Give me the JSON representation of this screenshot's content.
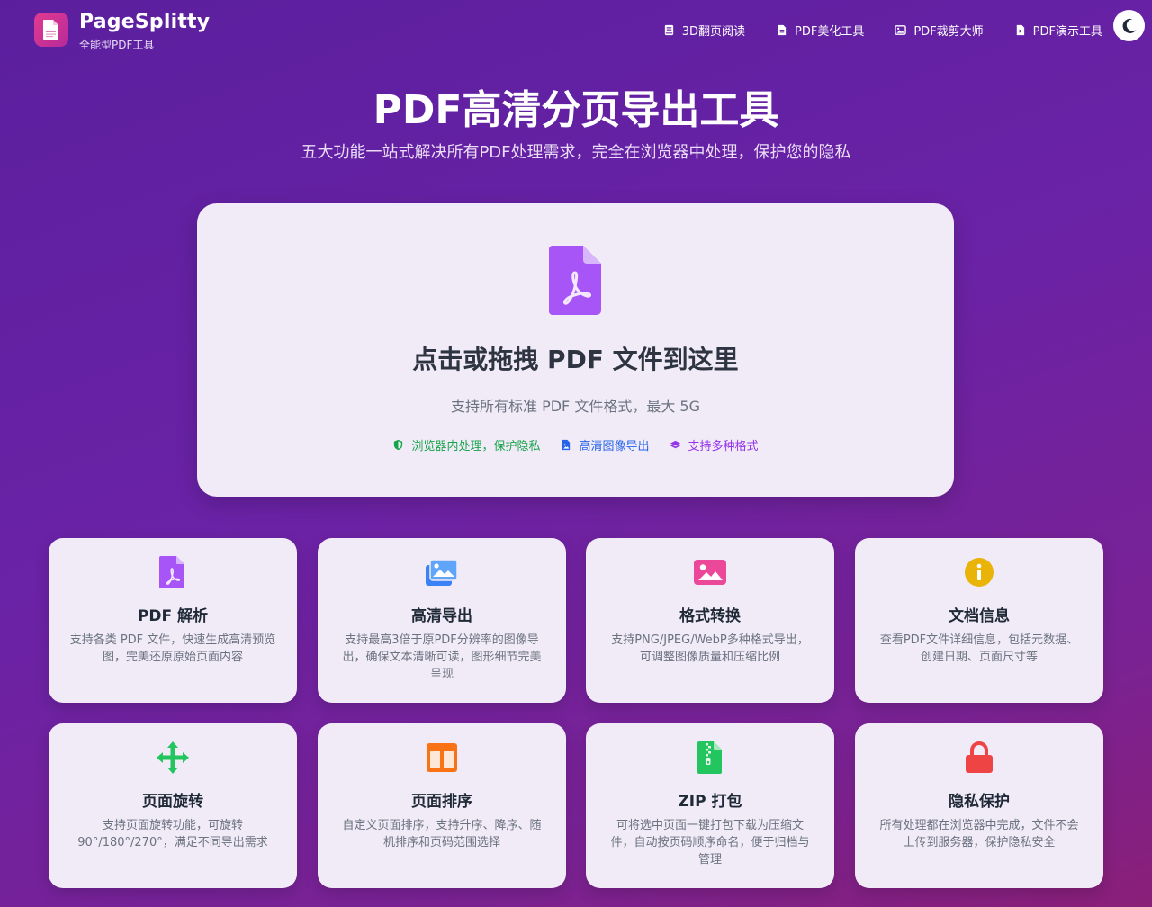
{
  "header": {
    "brand_name": "PageSplitty",
    "brand_sub": "全能型PDF工具",
    "nav": [
      {
        "label": "3D翻页阅读",
        "icon": "book-icon"
      },
      {
        "label": "PDF美化工具",
        "icon": "file-text-icon"
      },
      {
        "label": "PDF裁剪大师",
        "icon": "image-icon"
      },
      {
        "label": "PDF演示工具",
        "icon": "file-play-icon"
      }
    ],
    "theme_toggle_icon": "moon-icon"
  },
  "hero": {
    "title": "PDF高清分页导出工具",
    "subtitle": "五大功能一站式解决所有PDF处理需求，完全在浏览器中处理，保护您的隐私"
  },
  "upload": {
    "title": "点击或拖拽 PDF 文件到这里",
    "hint": "支持所有标准 PDF 文件格式，最大 5G",
    "badges": [
      {
        "label": "浏览器内处理，保护隐私",
        "icon": "shield-icon",
        "color": "#16a34a"
      },
      {
        "label": "高清图像导出",
        "icon": "file-image-icon",
        "color": "#2563eb"
      },
      {
        "label": "支持多种格式",
        "icon": "layers-icon",
        "color": "#9333ea"
      }
    ]
  },
  "features": [
    {
      "title": "PDF 解析",
      "desc": "支持各类 PDF 文件，快速生成高清预览图，完美还原原始页面内容",
      "icon": "pdf-file-icon",
      "color": "#a855f7"
    },
    {
      "title": "高清导出",
      "desc": "支持最高3倍于原PDF分辨率的图像导出，确保文本清晰可读，图形细节完美呈现",
      "icon": "images-icon",
      "color": "#3b82f6"
    },
    {
      "title": "格式转换",
      "desc": "支持PNG/JPEG/WebP多种格式导出，可调整图像质量和压缩比例",
      "icon": "image-icon",
      "color": "#ec4899"
    },
    {
      "title": "文档信息",
      "desc": "查看PDF文件详细信息，包括元数据、创建日期、页面尺寸等",
      "icon": "info-icon",
      "color": "#eab308"
    },
    {
      "title": "页面旋转",
      "desc": "支持页面旋转功能，可旋转90°/180°/270°，满足不同导出需求",
      "icon": "arrows-move-icon",
      "color": "#22c55e"
    },
    {
      "title": "页面排序",
      "desc": "自定义页面排序，支持升序、降序、随机排序和页码范围选择",
      "icon": "columns-icon",
      "color": "#f97316"
    },
    {
      "title": "ZIP 打包",
      "desc": "可将选中页面一键打包下载为压缩文件，自动按页码顺序命名，便于归档与管理",
      "icon": "zip-file-icon",
      "color": "#22c55e"
    },
    {
      "title": "隐私保护",
      "desc": "所有处理都在浏览器中完成，文件不会上传到服务器，保护隐私安全",
      "icon": "lock-icon",
      "color": "#ef4444"
    }
  ]
}
